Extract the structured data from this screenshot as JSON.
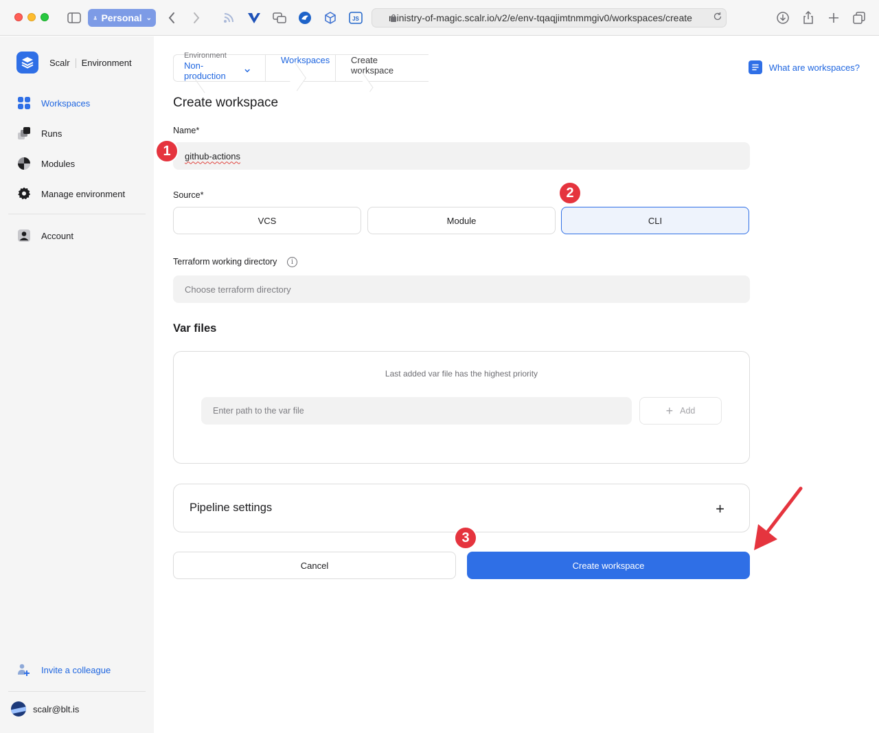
{
  "browser": {
    "profile_label": "Personal",
    "url": "ministry-of-magic.scalr.io/v2/e/env-tqaqjimtnmmgiv0/workspaces/create"
  },
  "sidebar": {
    "brand_name": "Scalr",
    "context_label": "Environment",
    "items": [
      {
        "label": "Workspaces",
        "icon": "grid-icon",
        "active": true
      },
      {
        "label": "Runs",
        "icon": "runs-icon"
      },
      {
        "label": "Modules",
        "icon": "modules-icon"
      },
      {
        "label": "Manage environment",
        "icon": "gear-icon"
      },
      {
        "label": "Account",
        "icon": "account-icon"
      }
    ],
    "invite_label": "Invite a colleague",
    "user_email": "scalr@blt.is"
  },
  "breadcrumb": {
    "env_caption": "Environment",
    "env_value": "Non-production",
    "workspaces": "Workspaces",
    "current": "Create workspace"
  },
  "help_link": "What are workspaces?",
  "form": {
    "title": "Create workspace",
    "name_label": "Name*",
    "name_value": "github-actions",
    "source_label": "Source*",
    "source_options": [
      "VCS",
      "Module",
      "CLI"
    ],
    "source_selected": "CLI",
    "tf_dir_label": "Terraform working directory",
    "tf_dir_placeholder": "Choose terraform directory",
    "var_files_title": "Var files",
    "var_files_hint": "Last added var file has the highest priority",
    "var_file_placeholder": "Enter path to the var file",
    "add_label": "Add",
    "pipeline_label": "Pipeline settings",
    "cancel_label": "Cancel",
    "submit_label": "Create workspace"
  },
  "annotations": {
    "steps": [
      "1",
      "2",
      "3"
    ],
    "color": "#e5343e"
  },
  "colors": {
    "accent": "#2f6fe6",
    "link": "#1f66e0"
  }
}
